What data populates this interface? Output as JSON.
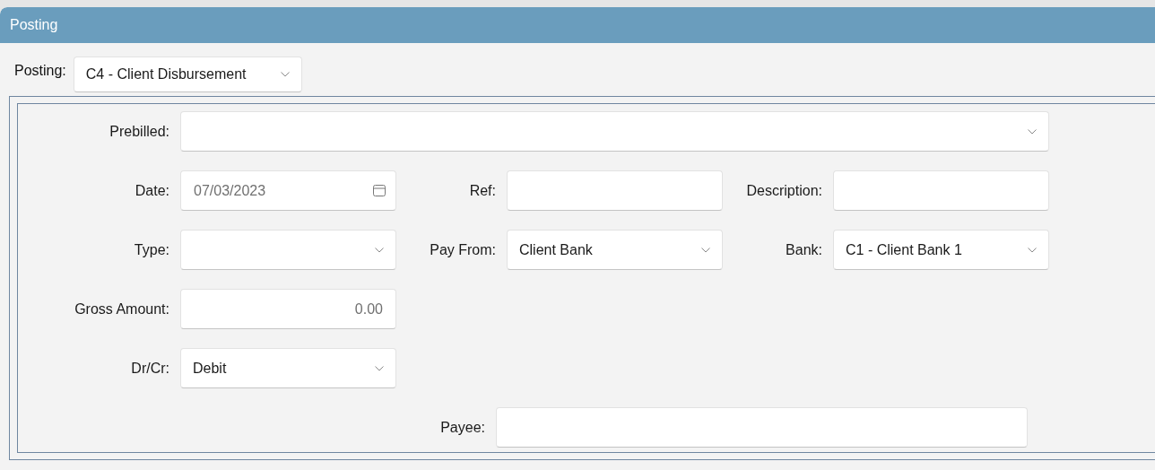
{
  "panel": {
    "title": "Posting"
  },
  "posting": {
    "label": "Posting:",
    "kind": "dropdown",
    "value": "C4 - Client Disbursement"
  },
  "prebilled": {
    "label": "Prebilled:",
    "kind": "dropdown"
  },
  "rows": [
    [
      {
        "label": "Date:",
        "kind": "date",
        "placeholder": "07/03/2023"
      },
      {
        "label": "Ref:",
        "kind": "text"
      },
      {
        "label": "Description:",
        "kind": "text"
      }
    ],
    [
      {
        "label": "Type:",
        "kind": "dropdown"
      },
      {
        "label": "Pay From:",
        "kind": "dropdown",
        "value": "Client Bank"
      },
      {
        "label": "Bank:",
        "kind": "dropdown",
        "value": "C1 - Client Bank 1"
      }
    ],
    [
      {
        "label": "Gross Amount:",
        "kind": "number",
        "placeholder": "0.00"
      }
    ],
    [
      {
        "label": "Dr/Cr:",
        "kind": "dropdown",
        "value": "Debit"
      }
    ]
  ],
  "payee": {
    "label": "Payee:",
    "kind": "text"
  }
}
